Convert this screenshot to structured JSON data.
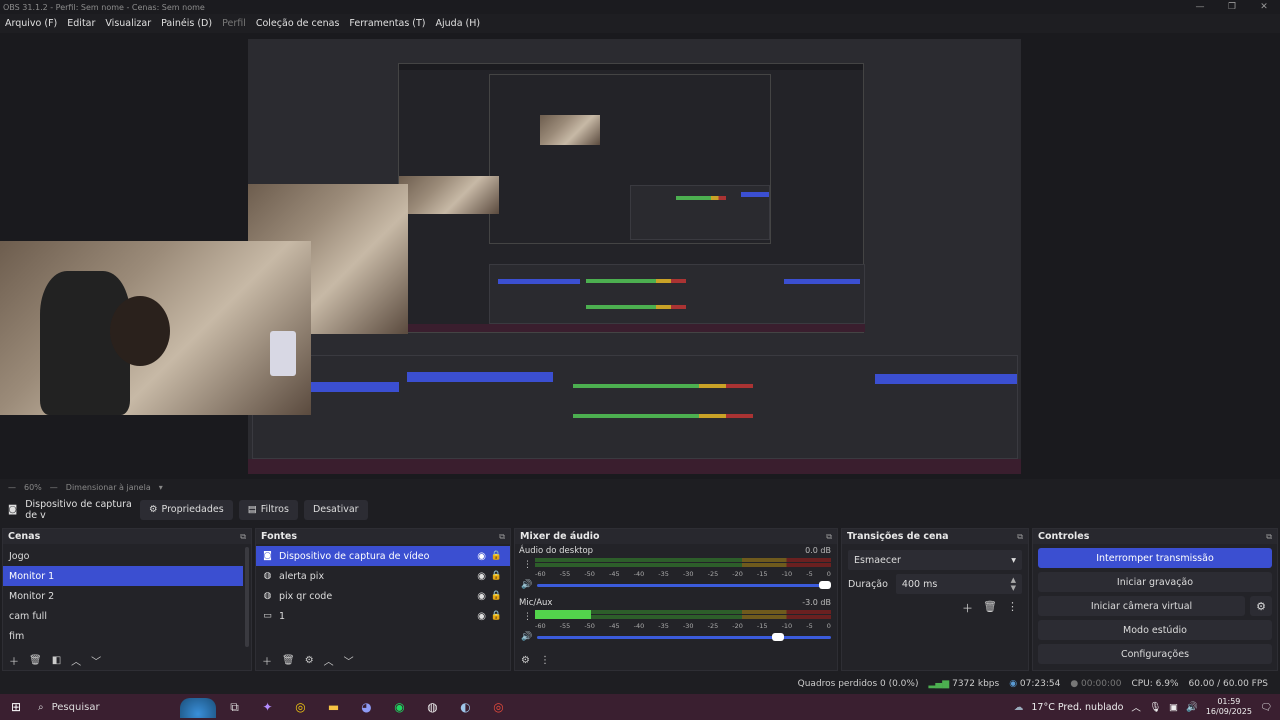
{
  "window": {
    "title": "OBS 31.1.2 - Perfil: Sem nome - Cenas: Sem nome",
    "min": "—",
    "max": "❐",
    "close": "✕"
  },
  "menu": [
    {
      "label": "Arquivo (F)",
      "disabled": false
    },
    {
      "label": "Editar",
      "disabled": false
    },
    {
      "label": "Visualizar",
      "disabled": false
    },
    {
      "label": "Painéis (D)",
      "disabled": false
    },
    {
      "label": "Perfil",
      "disabled": true
    },
    {
      "label": "Coleção de cenas",
      "disabled": false
    },
    {
      "label": "Ferramentas (T)",
      "disabled": false
    },
    {
      "label": "Ajuda (H)",
      "disabled": false
    }
  ],
  "preview": {
    "zoom": "60%",
    "resize_label": "Dimensionar à janela"
  },
  "source_toolbar": {
    "source_name": "Dispositivo de captura de v",
    "properties": "Propriedades",
    "filters": "Filtros",
    "deactivate": "Desativar"
  },
  "scenes": {
    "title": "Cenas",
    "items": [
      "Jogo",
      "Monitor 1",
      "Monitor 2",
      "cam full",
      "fim"
    ],
    "selected_index": 1
  },
  "sources": {
    "title": "Fontes",
    "items": [
      {
        "label": "Dispositivo de captura de vídeo",
        "icon": "camera-icon",
        "selected": true
      },
      {
        "label": "alerta pix",
        "icon": "globe-icon",
        "selected": false
      },
      {
        "label": "pix qr code",
        "icon": "globe-icon",
        "selected": false
      },
      {
        "label": "1",
        "icon": "monitor-icon",
        "selected": false
      }
    ]
  },
  "mixer": {
    "title": "Mixer de áudio",
    "ticks": [
      "-60",
      "-55",
      "-50",
      "-45",
      "-40",
      "-35",
      "-30",
      "-25",
      "-20",
      "-15",
      "-10",
      "-5",
      "0"
    ],
    "channels": [
      {
        "name": "Áudio do desktop",
        "db": "0.0 dB",
        "level": 0.0,
        "volume": 1.0
      },
      {
        "name": "Mic/Aux",
        "db": "-3.0 dB",
        "level": 0.19,
        "volume": 0.84
      }
    ]
  },
  "transitions": {
    "title": "Transições de cena",
    "selected": "Esmaecer",
    "duration_label": "Duração",
    "duration_value": "400 ms"
  },
  "controls": {
    "title": "Controles",
    "stop_stream": "Interromper transmissão",
    "start_recording": "Iniciar gravação",
    "start_virtual_cam": "Iniciar câmera virtual",
    "studio_mode": "Modo estúdio",
    "settings": "Configurações"
  },
  "status": {
    "dropped_frames": "Quadros perdidos 0 (0.0%)",
    "bitrate": "7372 kbps",
    "stream_time": "07:23:54",
    "rec_time": "00:00:00",
    "cpu": "CPU: 6.9%",
    "fps": "60.00 / 60.00 FPS"
  },
  "taskbar": {
    "search_placeholder": "Pesquisar",
    "weather": "17°C  Pred. nublado",
    "time": "01:59",
    "date": "16/09/2025"
  },
  "colors": {
    "accent": "#3b4fd1",
    "meter_green": "#53d44c",
    "taskbar": "#3a1f30"
  }
}
